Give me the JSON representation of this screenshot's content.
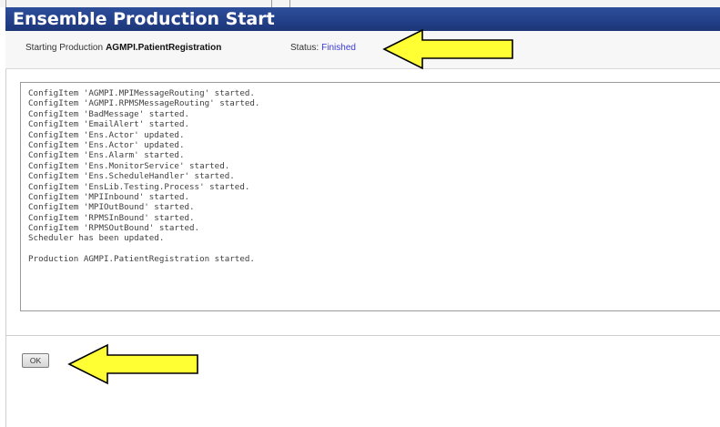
{
  "window": {
    "title": "Ensemble Production Start"
  },
  "status_bar": {
    "starting_label": "Starting Production",
    "production_name": "AGMPI.PatientRegistration",
    "status_label": "Status:",
    "status_value": "Finished",
    "status_color": "#3a3ad8"
  },
  "log": {
    "lines": [
      "ConfigItem 'AGMPI.MPIMessageRouting' started.",
      "ConfigItem 'AGMPI.RPMSMessageRouting' started.",
      "ConfigItem 'BadMessage' started.",
      "ConfigItem 'EmailAlert' started.",
      "ConfigItem 'Ens.Actor' updated.",
      "ConfigItem 'Ens.Actor' updated.",
      "ConfigItem 'Ens.Alarm' started.",
      "ConfigItem 'Ens.MonitorService' started.",
      "ConfigItem 'Ens.ScheduleHandler' started.",
      "ConfigItem 'EnsLib.Testing.Process' started.",
      "ConfigItem 'MPIInbound' started.",
      "ConfigItem 'MPIOutBound' started.",
      "ConfigItem 'RPMSInBound' started.",
      "ConfigItem 'RPMSOutBound' started.",
      "Scheduler has been updated."
    ],
    "final_line": "Production AGMPI.PatientRegistration started."
  },
  "actions": {
    "ok_label": "OK"
  },
  "annotations": {
    "arrow_color": "#ffff33",
    "arrow_outline": "#000000",
    "title_bar_color": "#23408a"
  }
}
